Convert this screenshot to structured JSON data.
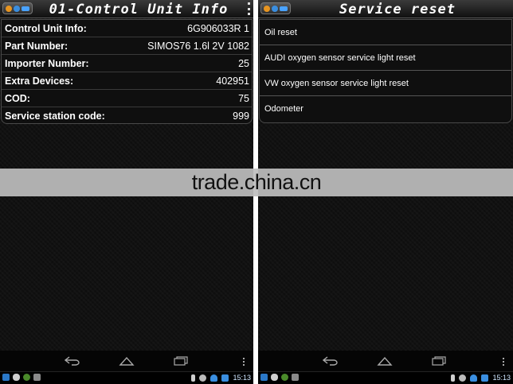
{
  "left_screen": {
    "title": "01-Control Unit Info",
    "rows": [
      {
        "label": "Control Unit Info:",
        "value": "6G906033R 1"
      },
      {
        "label": "Part Number:",
        "value": "SIMOS76 1.6l 2V 1082"
      },
      {
        "label": "Importer Number:",
        "value": "25"
      },
      {
        "label": "Extra Devices:",
        "value": "402951"
      },
      {
        "label": "COD:",
        "value": "75"
      },
      {
        "label": "Service station code:",
        "value": "999"
      }
    ]
  },
  "right_screen": {
    "title": "Service reset",
    "items": [
      {
        "label": "Oil reset"
      },
      {
        "label": "AUDI oxygen sensor service light reset"
      },
      {
        "label": "VW oxygen sensor service light reset"
      },
      {
        "label": "Odometer"
      }
    ]
  },
  "status_bar": {
    "time": "15:13"
  },
  "watermark": {
    "text": "trade.china.cn"
  },
  "colors": {
    "background": "#0e0e0e",
    "text": "#ffffff",
    "divider": "#3a3a3a",
    "status_icon_blue": "#3a8ee0"
  },
  "icons": {
    "nav": [
      "back-icon",
      "home-icon",
      "recent-apps-icon",
      "overflow-menu-icon"
    ],
    "status_left": [
      "app-icon",
      "cloud-icon",
      "usb-icon",
      "gamepad-icon"
    ],
    "status_right": [
      "battery-icon",
      "alarm-icon",
      "wifi-icon",
      "signal-icon"
    ]
  }
}
